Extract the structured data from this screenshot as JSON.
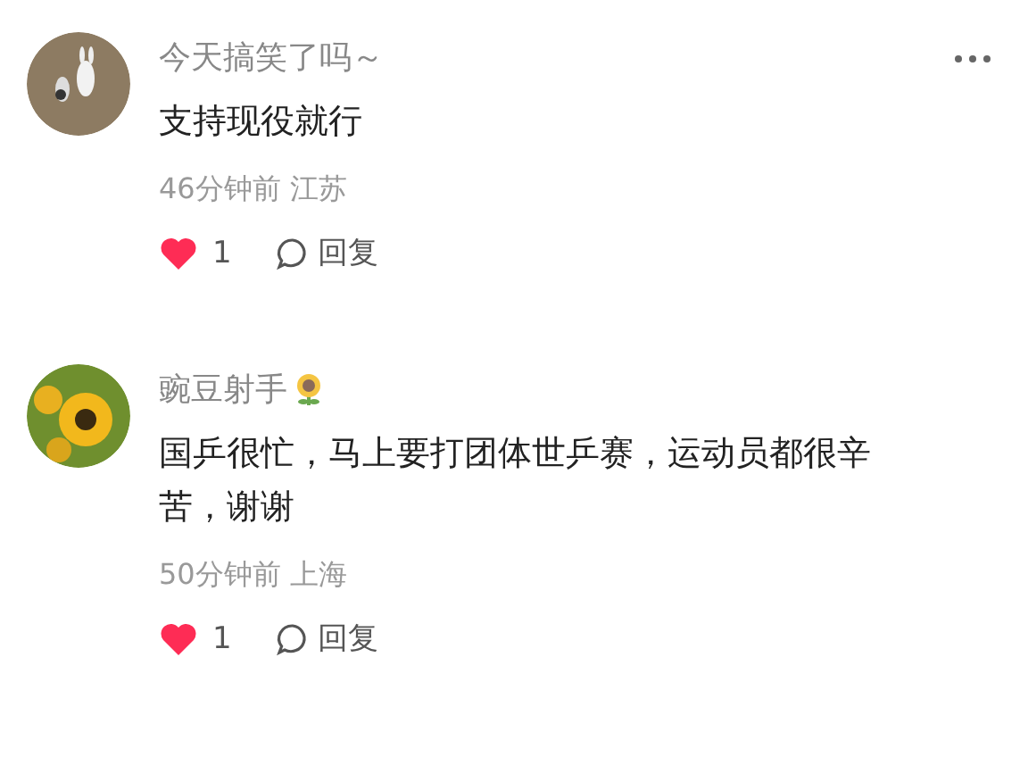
{
  "comments": [
    {
      "kind": "full",
      "name": "今天搞笑了吗～",
      "badge": false,
      "menu": true,
      "text": "支持现役就行",
      "meta": "46分钟前 江苏",
      "liked": true,
      "likes": "1",
      "reply": "回复"
    },
    {
      "kind": "full",
      "name": "豌豆射手",
      "badge": true,
      "menu": false,
      "text": "国乒很忙，马上要打团体世乒赛，运动员都很辛苦，谢谢",
      "meta": "50分钟前 上海",
      "liked": true,
      "likes": "1",
      "reply": "回复"
    },
    {
      "kind": "clipped"
    }
  ]
}
